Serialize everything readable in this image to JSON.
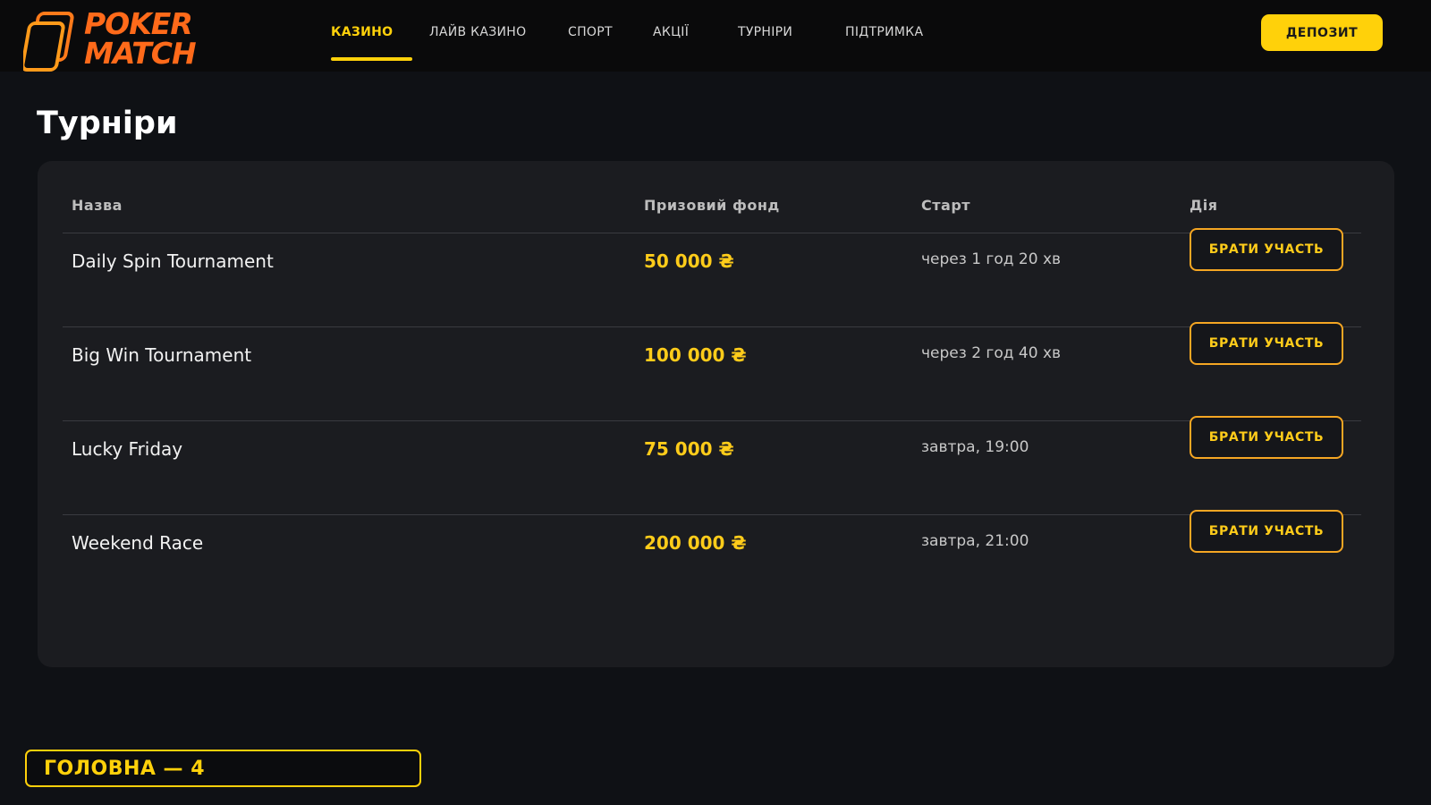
{
  "brand": {
    "line1": "POKER",
    "line2": "MATCH",
    "accent": "#ff6a1a"
  },
  "nav": {
    "items": [
      {
        "label": "КАЗИНО",
        "active": true
      },
      {
        "label": "ЛАЙВ КАЗИНО"
      },
      {
        "label": "СПОРТ"
      },
      {
        "label": "АКЦІЇ"
      },
      {
        "label": "ТУРНІРИ"
      },
      {
        "label": "ПІДТРИМКА"
      }
    ],
    "deposit_label": "ДЕПОЗИТ"
  },
  "page": {
    "title": "Турніри"
  },
  "table": {
    "headers": {
      "name": "Назва",
      "prize": "Призовий фонд",
      "start": "Старт",
      "action": "Дія"
    },
    "rows": [
      {
        "name": "Daily Spin Tournament",
        "prize": "50 000 ₴",
        "start": "через 1 год 20 хв",
        "action": "БРАТИ УЧАСТЬ"
      },
      {
        "name": "Big Win Tournament",
        "prize": "100 000 ₴",
        "start": "через 2 год 40 хв",
        "action": "БРАТИ УЧАСТЬ"
      },
      {
        "name": "Lucky Friday",
        "prize": "75 000 ₴",
        "start": "завтра, 19:00",
        "action": "БРАТИ УЧАСТЬ"
      },
      {
        "name": "Weekend Race",
        "prize": "200 000 ₴",
        "start": "завтра, 21:00",
        "action": "БРАТИ УЧАСТЬ"
      }
    ]
  },
  "footer": {
    "label": "ГОЛОВНА — 4"
  },
  "colors": {
    "accent": "#ffd10a",
    "button_border": "#f5a623",
    "background": "#0f1115",
    "panel": "#1b1c20"
  }
}
